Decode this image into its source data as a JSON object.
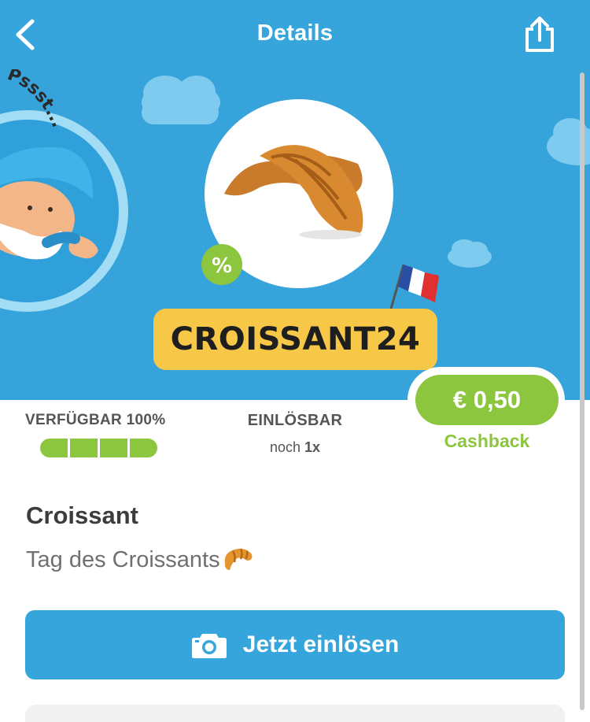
{
  "header": {
    "title": "Details",
    "back_icon": "chevron-left-icon",
    "share_icon": "share-icon"
  },
  "banner": {
    "mascot_text": "Pssst...",
    "code": "CROISSANT24",
    "percent_badge": "%",
    "flag": "french-flag"
  },
  "availability": {
    "label_prefix": "VERFÜGBAR",
    "label_value": "100%",
    "percent": 100
  },
  "redeemable": {
    "label": "EINLÖSBAR",
    "sub_prefix": "noch",
    "sub_value": "1x"
  },
  "cashback": {
    "amount": "€ 0,50",
    "label": "Cashback"
  },
  "product": {
    "title": "Croissant",
    "subtitle": "Tag des Croissants",
    "subtitle_emoji": "croissant-emoji"
  },
  "cta": {
    "label": "Jetzt einlösen",
    "icon": "camera-icon"
  },
  "colors": {
    "primary": "#35a5dc",
    "accent_green": "#8cc63f",
    "badge_yellow": "#f7c748"
  }
}
